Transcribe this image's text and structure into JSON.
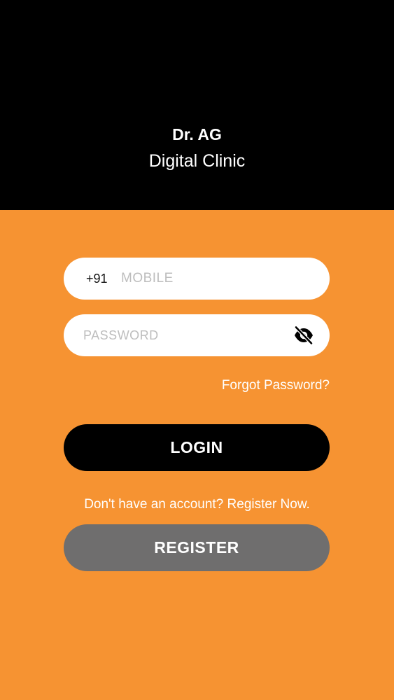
{
  "header": {
    "brand_name": "Dr. AG",
    "brand_subtitle": "Digital Clinic"
  },
  "login_form": {
    "mobile_prefix": "+91",
    "mobile_placeholder": "MOBILE",
    "mobile_value": "",
    "password_placeholder": "PASSWORD",
    "password_value": "",
    "password_toggle_icon": "eye-off-icon",
    "forgot_password_label": "Forgot Password?",
    "login_label": "LOGIN",
    "register_prompt": "Don't have an account? Register Now.",
    "register_label": "REGISTER"
  },
  "colors": {
    "header_bg": "#000000",
    "accent_orange": "#F69332",
    "login_button": "#000000",
    "register_button": "#6F6E6E",
    "field_bg": "#FFFFFF"
  }
}
